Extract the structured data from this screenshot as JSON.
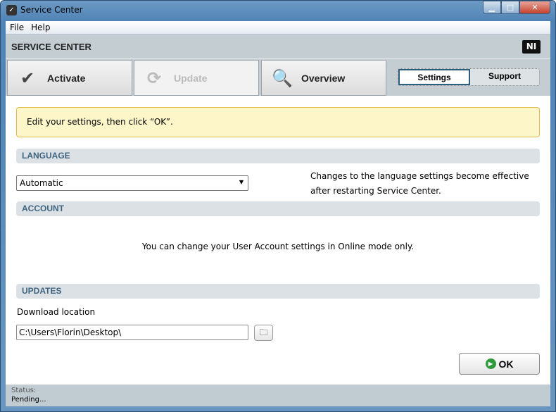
{
  "window": {
    "title": "Service Center",
    "minimize": "▁",
    "maximize": "□",
    "close": "✕"
  },
  "menu": [
    "File",
    "Help"
  ],
  "header": {
    "title": "SERVICE CENTER",
    "logo": "NI"
  },
  "tabs": [
    {
      "label": "Activate",
      "icon": "check-icon",
      "enabled": true
    },
    {
      "label": "Update",
      "icon": "refresh-icon",
      "enabled": false
    },
    {
      "label": "Overview",
      "icon": "magnifier-icon",
      "enabled": true
    }
  ],
  "segments": {
    "settings": "Settings",
    "support": "Support",
    "active": "Settings"
  },
  "notice": "Edit your settings, then click “OK”.",
  "language": {
    "header": "LANGUAGE",
    "selected": "Automatic",
    "help_line1": "Changes to the language settings become effective",
    "help_line2": "after restarting Service Center."
  },
  "account": {
    "header": "ACCOUNT",
    "message": "You can change your User Account settings in Online mode only."
  },
  "updates": {
    "header": "UPDATES",
    "download_label": "Download location",
    "path": "C:\\Users\\Florin\\Desktop\\"
  },
  "ok_label": "OK",
  "status": {
    "label": "Status:",
    "value": "Pending..."
  }
}
